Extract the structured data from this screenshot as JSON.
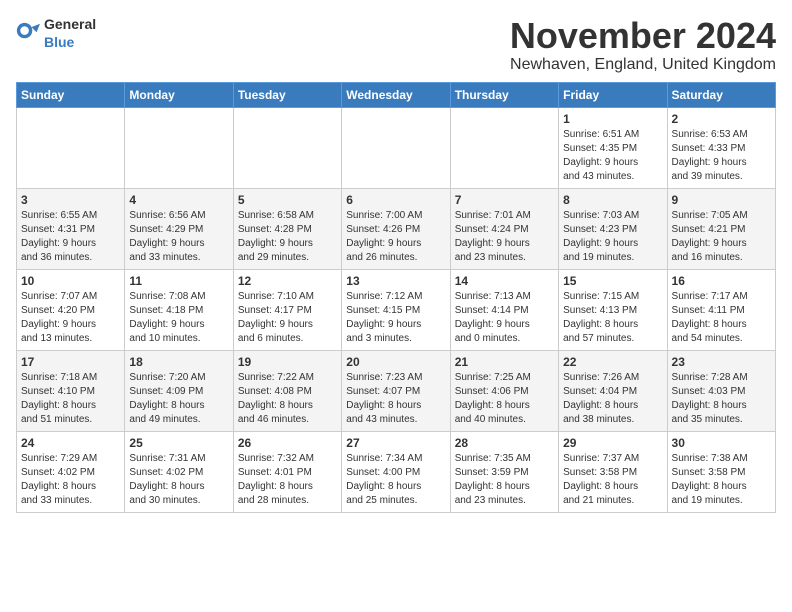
{
  "logo": {
    "general": "General",
    "blue": "Blue"
  },
  "title": "November 2024",
  "location": "Newhaven, England, United Kingdom",
  "days_of_week": [
    "Sunday",
    "Monday",
    "Tuesday",
    "Wednesday",
    "Thursday",
    "Friday",
    "Saturday"
  ],
  "weeks": [
    [
      {
        "day": "",
        "info": ""
      },
      {
        "day": "",
        "info": ""
      },
      {
        "day": "",
        "info": ""
      },
      {
        "day": "",
        "info": ""
      },
      {
        "day": "",
        "info": ""
      },
      {
        "day": "1",
        "info": "Sunrise: 6:51 AM\nSunset: 4:35 PM\nDaylight: 9 hours\nand 43 minutes."
      },
      {
        "day": "2",
        "info": "Sunrise: 6:53 AM\nSunset: 4:33 PM\nDaylight: 9 hours\nand 39 minutes."
      }
    ],
    [
      {
        "day": "3",
        "info": "Sunrise: 6:55 AM\nSunset: 4:31 PM\nDaylight: 9 hours\nand 36 minutes."
      },
      {
        "day": "4",
        "info": "Sunrise: 6:56 AM\nSunset: 4:29 PM\nDaylight: 9 hours\nand 33 minutes."
      },
      {
        "day": "5",
        "info": "Sunrise: 6:58 AM\nSunset: 4:28 PM\nDaylight: 9 hours\nand 29 minutes."
      },
      {
        "day": "6",
        "info": "Sunrise: 7:00 AM\nSunset: 4:26 PM\nDaylight: 9 hours\nand 26 minutes."
      },
      {
        "day": "7",
        "info": "Sunrise: 7:01 AM\nSunset: 4:24 PM\nDaylight: 9 hours\nand 23 minutes."
      },
      {
        "day": "8",
        "info": "Sunrise: 7:03 AM\nSunset: 4:23 PM\nDaylight: 9 hours\nand 19 minutes."
      },
      {
        "day": "9",
        "info": "Sunrise: 7:05 AM\nSunset: 4:21 PM\nDaylight: 9 hours\nand 16 minutes."
      }
    ],
    [
      {
        "day": "10",
        "info": "Sunrise: 7:07 AM\nSunset: 4:20 PM\nDaylight: 9 hours\nand 13 minutes."
      },
      {
        "day": "11",
        "info": "Sunrise: 7:08 AM\nSunset: 4:18 PM\nDaylight: 9 hours\nand 10 minutes."
      },
      {
        "day": "12",
        "info": "Sunrise: 7:10 AM\nSunset: 4:17 PM\nDaylight: 9 hours\nand 6 minutes."
      },
      {
        "day": "13",
        "info": "Sunrise: 7:12 AM\nSunset: 4:15 PM\nDaylight: 9 hours\nand 3 minutes."
      },
      {
        "day": "14",
        "info": "Sunrise: 7:13 AM\nSunset: 4:14 PM\nDaylight: 9 hours\nand 0 minutes."
      },
      {
        "day": "15",
        "info": "Sunrise: 7:15 AM\nSunset: 4:13 PM\nDaylight: 8 hours\nand 57 minutes."
      },
      {
        "day": "16",
        "info": "Sunrise: 7:17 AM\nSunset: 4:11 PM\nDaylight: 8 hours\nand 54 minutes."
      }
    ],
    [
      {
        "day": "17",
        "info": "Sunrise: 7:18 AM\nSunset: 4:10 PM\nDaylight: 8 hours\nand 51 minutes."
      },
      {
        "day": "18",
        "info": "Sunrise: 7:20 AM\nSunset: 4:09 PM\nDaylight: 8 hours\nand 49 minutes."
      },
      {
        "day": "19",
        "info": "Sunrise: 7:22 AM\nSunset: 4:08 PM\nDaylight: 8 hours\nand 46 minutes."
      },
      {
        "day": "20",
        "info": "Sunrise: 7:23 AM\nSunset: 4:07 PM\nDaylight: 8 hours\nand 43 minutes."
      },
      {
        "day": "21",
        "info": "Sunrise: 7:25 AM\nSunset: 4:06 PM\nDaylight: 8 hours\nand 40 minutes."
      },
      {
        "day": "22",
        "info": "Sunrise: 7:26 AM\nSunset: 4:04 PM\nDaylight: 8 hours\nand 38 minutes."
      },
      {
        "day": "23",
        "info": "Sunrise: 7:28 AM\nSunset: 4:03 PM\nDaylight: 8 hours\nand 35 minutes."
      }
    ],
    [
      {
        "day": "24",
        "info": "Sunrise: 7:29 AM\nSunset: 4:02 PM\nDaylight: 8 hours\nand 33 minutes."
      },
      {
        "day": "25",
        "info": "Sunrise: 7:31 AM\nSunset: 4:02 PM\nDaylight: 8 hours\nand 30 minutes."
      },
      {
        "day": "26",
        "info": "Sunrise: 7:32 AM\nSunset: 4:01 PM\nDaylight: 8 hours\nand 28 minutes."
      },
      {
        "day": "27",
        "info": "Sunrise: 7:34 AM\nSunset: 4:00 PM\nDaylight: 8 hours\nand 25 minutes."
      },
      {
        "day": "28",
        "info": "Sunrise: 7:35 AM\nSunset: 3:59 PM\nDaylight: 8 hours\nand 23 minutes."
      },
      {
        "day": "29",
        "info": "Sunrise: 7:37 AM\nSunset: 3:58 PM\nDaylight: 8 hours\nand 21 minutes."
      },
      {
        "day": "30",
        "info": "Sunrise: 7:38 AM\nSunset: 3:58 PM\nDaylight: 8 hours\nand 19 minutes."
      }
    ]
  ]
}
